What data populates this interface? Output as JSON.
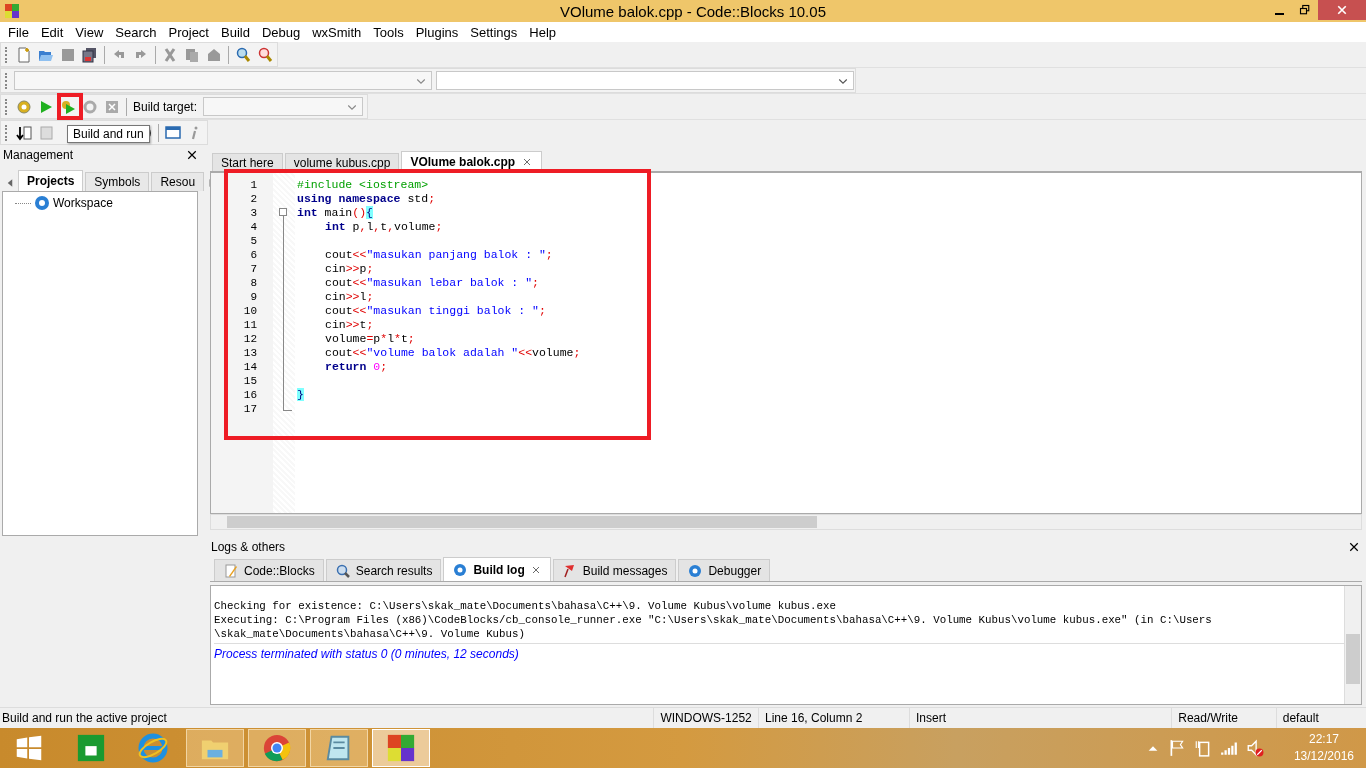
{
  "window": {
    "title": "VOlume balok.cpp - Code::Blocks 10.05"
  },
  "menu": [
    "File",
    "Edit",
    "View",
    "Search",
    "Project",
    "Build",
    "Debug",
    "wxSmith",
    "Tools",
    "Plugins",
    "Settings",
    "Help"
  ],
  "build_toolbar": {
    "target_label": "Build target:"
  },
  "tooltip": "Build and run",
  "management": {
    "title": "Management",
    "tabs": [
      {
        "label": "Projects",
        "selected": true
      },
      {
        "label": "Symbols",
        "selected": false
      },
      {
        "label": "Resou",
        "selected": false
      }
    ],
    "tree": [
      {
        "label": "Workspace"
      }
    ]
  },
  "editor": {
    "tabs": [
      {
        "label": "Start here",
        "selected": false
      },
      {
        "label": "volume kubus.cpp",
        "selected": false
      },
      {
        "label": "VOlume balok.cpp",
        "selected": true
      }
    ],
    "lines": [
      {
        "number": "1",
        "indented": false,
        "tokens": [
          {
            "kind": "pre",
            "text": "#include <iostream>"
          }
        ]
      },
      {
        "number": "2",
        "indented": false,
        "tokens": [
          {
            "kind": "kw",
            "text": "using namespace"
          },
          {
            "kind": "plain",
            "text": " std"
          },
          {
            "kind": "op",
            "text": ";"
          }
        ]
      },
      {
        "number": "3",
        "indented": false,
        "tokens": [
          {
            "kind": "kw",
            "text": "int"
          },
          {
            "kind": "plain",
            "text": " main"
          },
          {
            "kind": "op",
            "text": "()"
          },
          {
            "kind": "brace",
            "text": "{"
          }
        ]
      },
      {
        "number": "4",
        "indented": true,
        "tokens": [
          {
            "kind": "kw",
            "text": "int"
          },
          {
            "kind": "plain",
            "text": " p"
          },
          {
            "kind": "op",
            "text": ","
          },
          {
            "kind": "plain",
            "text": "l"
          },
          {
            "kind": "op",
            "text": ","
          },
          {
            "kind": "plain",
            "text": "t"
          },
          {
            "kind": "op",
            "text": ","
          },
          {
            "kind": "plain",
            "text": "volume"
          },
          {
            "kind": "op",
            "text": ";"
          }
        ]
      },
      {
        "number": "5"
      },
      {
        "number": "6",
        "indented": true,
        "tokens": [
          {
            "kind": "plain",
            "text": "cout"
          },
          {
            "kind": "op",
            "text": "<<"
          },
          {
            "kind": "str",
            "text": "\"masukan panjang balok : \""
          },
          {
            "kind": "op",
            "text": ";"
          }
        ]
      },
      {
        "number": "7",
        "indented": true,
        "tokens": [
          {
            "kind": "plain",
            "text": "cin"
          },
          {
            "kind": "op",
            "text": ">>"
          },
          {
            "kind": "plain",
            "text": "p"
          },
          {
            "kind": "op",
            "text": ";"
          }
        ]
      },
      {
        "number": "8",
        "indented": true,
        "tokens": [
          {
            "kind": "plain",
            "text": "cout"
          },
          {
            "kind": "op",
            "text": "<<"
          },
          {
            "kind": "str",
            "text": "\"masukan lebar balok : \""
          },
          {
            "kind": "op",
            "text": ";"
          }
        ]
      },
      {
        "number": "9",
        "indented": true,
        "tokens": [
          {
            "kind": "plain",
            "text": "cin"
          },
          {
            "kind": "op",
            "text": ">>"
          },
          {
            "kind": "plain",
            "text": "l"
          },
          {
            "kind": "op",
            "text": ";"
          }
        ]
      },
      {
        "number": "10",
        "indented": true,
        "tokens": [
          {
            "kind": "plain",
            "text": "cout"
          },
          {
            "kind": "op",
            "text": "<<"
          },
          {
            "kind": "str",
            "text": "\"masukan tinggi balok : \""
          },
          {
            "kind": "op",
            "text": ";"
          }
        ]
      },
      {
        "number": "11",
        "indented": true,
        "tokens": [
          {
            "kind": "plain",
            "text": "cin"
          },
          {
            "kind": "op",
            "text": ">>"
          },
          {
            "kind": "plain",
            "text": "t"
          },
          {
            "kind": "op",
            "text": ";"
          }
        ]
      },
      {
        "number": "12",
        "indented": true,
        "tokens": [
          {
            "kind": "plain",
            "text": "volume"
          },
          {
            "kind": "op",
            "text": "="
          },
          {
            "kind": "plain",
            "text": "p"
          },
          {
            "kind": "op",
            "text": "*"
          },
          {
            "kind": "plain",
            "text": "l"
          },
          {
            "kind": "op",
            "text": "*"
          },
          {
            "kind": "plain",
            "text": "t"
          },
          {
            "kind": "op",
            "text": ";"
          }
        ]
      },
      {
        "number": "13",
        "indented": true,
        "tokens": [
          {
            "kind": "plain",
            "text": "cout"
          },
          {
            "kind": "op",
            "text": "<<"
          },
          {
            "kind": "str",
            "text": "\"volume balok adalah \""
          },
          {
            "kind": "op",
            "text": "<<"
          },
          {
            "kind": "plain",
            "text": "volume"
          },
          {
            "kind": "op",
            "text": ";"
          }
        ]
      },
      {
        "number": "14",
        "indented": true,
        "tokens": [
          {
            "kind": "kw",
            "text": "return"
          },
          {
            "kind": "num",
            "text": " 0"
          },
          {
            "kind": "op",
            "text": ";"
          }
        ]
      },
      {
        "number": "15"
      },
      {
        "number": "16",
        "indented": false,
        "tokens": [
          {
            "kind": "brace",
            "text": "}"
          }
        ]
      },
      {
        "number": "17"
      }
    ]
  },
  "logs": {
    "title": "Logs & others",
    "tabs": [
      {
        "label": "Code::Blocks",
        "selected": false
      },
      {
        "label": "Search results",
        "selected": false
      },
      {
        "label": "Build log",
        "selected": true
      },
      {
        "label": "Build messages",
        "selected": false
      },
      {
        "label": "Debugger",
        "selected": false
      }
    ],
    "lines": [
      {
        "kind": "info",
        "text": "Checking for existence: C:\\Users\\skak_mate\\Documents\\bahasa\\C++\\9. Volume Kubus\\volume kubus.exe"
      },
      {
        "kind": "info",
        "text": "Executing: C:\\Program Files (x86)\\CodeBlocks/cb_console_runner.exe \"C:\\Users\\skak_mate\\Documents\\bahasa\\C++\\9. Volume Kubus\\volume kubus.exe\" (in C:\\Users"
      },
      {
        "kind": "info",
        "text": "\\skak_mate\\Documents\\bahasa\\C++\\9. Volume Kubus)"
      },
      {
        "kind": "status",
        "text": "Process terminated with status 0 (0 minutes, 12 seconds)"
      }
    ]
  },
  "status_bar": [
    "Build and run the active project",
    "WINDOWS-1252",
    "Line 16, Column 2",
    "Insert",
    "Read/Write",
    "default"
  ],
  "taskbar": {
    "time": "22:17",
    "date": "13/12/2016"
  }
}
